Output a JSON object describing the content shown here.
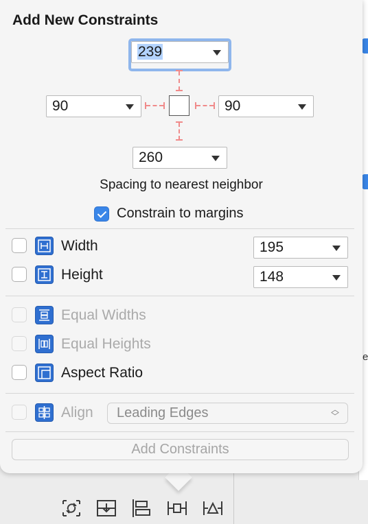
{
  "popover": {
    "title": "Add New Constraints",
    "spacing": {
      "top": "239",
      "left": "90",
      "right": "90",
      "bottom": "260"
    },
    "spacing_caption": "Spacing to nearest neighbor",
    "constrain_to_margins": {
      "label": "Constrain to margins",
      "checked": true
    },
    "size": [
      {
        "label": "Width",
        "value": "195",
        "icon": "width-constraint-icon"
      },
      {
        "label": "Height",
        "value": "148",
        "icon": "height-constraint-icon"
      }
    ],
    "equality": [
      {
        "label": "Equal Widths",
        "enabled": false,
        "icon": "equal-widths-icon"
      },
      {
        "label": "Equal Heights",
        "enabled": false,
        "icon": "equal-heights-icon"
      },
      {
        "label": "Aspect Ratio",
        "enabled": true,
        "icon": "aspect-ratio-icon"
      }
    ],
    "align": {
      "label": "Align",
      "value": "Leading Edges",
      "enabled": false,
      "icon": "align-icon"
    },
    "add_button": "Add Constraints"
  },
  "toolbar": {
    "icons": [
      "update-frames-icon",
      "stack-view-icon",
      "align-constraints-icon",
      "pin-constraints-icon",
      "resolve-issues-icon"
    ]
  },
  "colors": {
    "accent": "#3a86e8",
    "constraint_line": "#f08a8a",
    "icon_blue": "#2f6fd0"
  }
}
